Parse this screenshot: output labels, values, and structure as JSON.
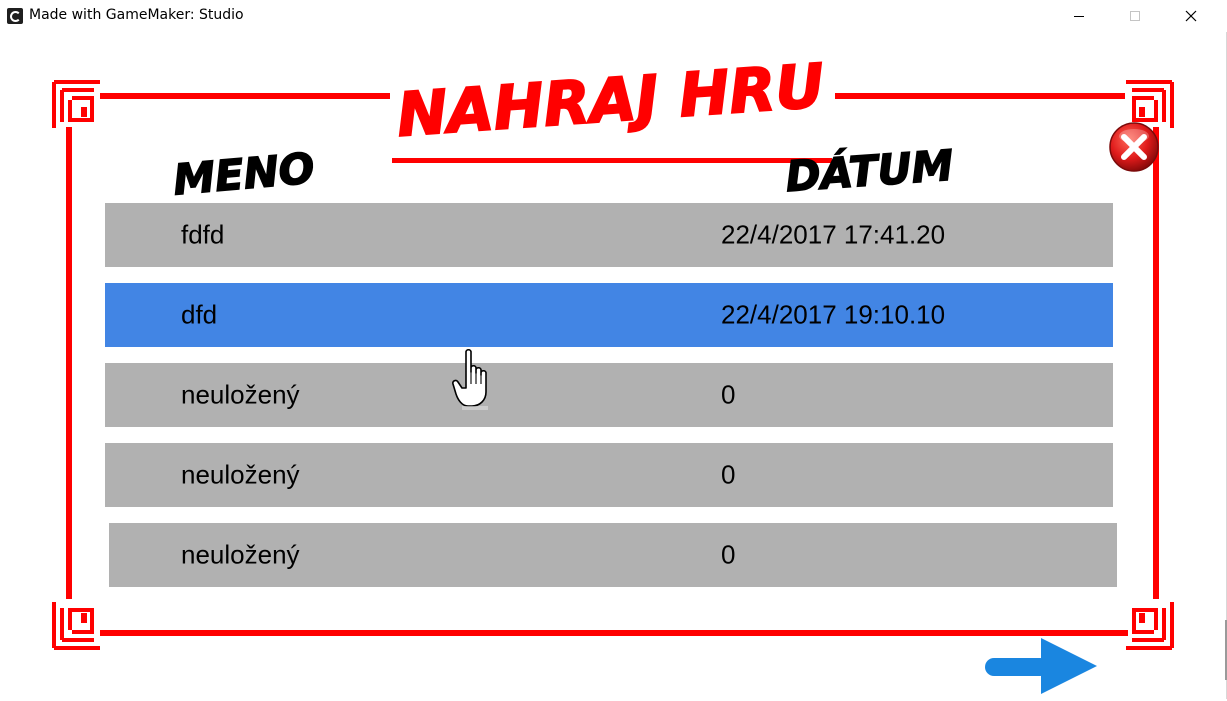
{
  "window": {
    "title": "Made with GameMaker: Studio"
  },
  "screen": {
    "title": "NAHRAJ HRU",
    "columns": {
      "name": "MENO",
      "date": "DÁTUM"
    },
    "slots": [
      {
        "name": "fdfd",
        "date": "22/4/2017 17:41.20",
        "selected": false
      },
      {
        "name": "dfd",
        "date": "22/4/2017 19:10.10",
        "selected": true
      },
      {
        "name": "neuložený",
        "date": "0",
        "selected": false
      },
      {
        "name": "neuložený",
        "date": "0",
        "selected": false
      },
      {
        "name": "neuložený",
        "date": "0",
        "selected": false
      }
    ]
  },
  "icons": {
    "app": "gamemaker-icon",
    "close": "close-icon",
    "next": "arrow-right-icon",
    "cursor": "hand-pointer-icon"
  },
  "colors": {
    "frame": "#ff0000",
    "slot": "#b1b1b1",
    "slot_selected": "#4285e4",
    "close_button": "#e01b1b",
    "next_arrow": "#1a86e0"
  }
}
